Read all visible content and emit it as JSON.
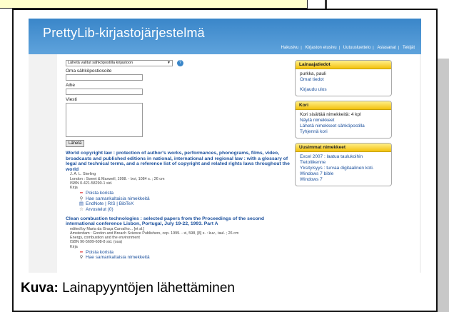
{
  "app": {
    "title": "PrettyLib-kirjastojärjestelmä",
    "nav": [
      "Hakusivu",
      "Kirjaston etusivu",
      "Uutuusluettelo",
      "Asiasanat",
      "Tekijät"
    ]
  },
  "form": {
    "select_label": "Lähetä valitut sähköpostilla kirjastoon",
    "email_label": "Oma sähköpostiosoite",
    "subject_label": "Aihe",
    "message_label": "Viesti",
    "send_button": "Lähetä"
  },
  "records": [
    {
      "title": "World copyright law : protection of author's works, performances, phonograms, films, video, broadcasts and published editions in national, international and regional law : with a glossary of legal and technical terms, and a reference list of copyright and related rights laws throughout the world",
      "meta": [
        "J. A. L. Sterling",
        "London : Sweet & Maxwell, 1998. - lxvi, 1084 s. ; 26 cm",
        "ISBN 0-421-58290-1 sid.",
        "Kirja"
      ],
      "actions": [
        {
          "icon": "remove-icon",
          "label": "Poista korista"
        },
        {
          "icon": "search-icon",
          "label": "Hae samankaltaisia nimekkeitä"
        },
        {
          "icon": "export-icon",
          "label": "EndNote | RIS | BibTeX"
        },
        {
          "icon": "star-icon",
          "label": "Arvostelut (0)"
        }
      ]
    },
    {
      "title": "Clean combustion technologies : selected papers from the Proceedings of the second international conference Lisbon, Portugal, July 19-22, 1993. Part A",
      "meta": [
        "edited by Maria da Graça Carvalho... [et al.]",
        "Amsterdam : Gordon and Breach Science Publishers, cop. 1999. - xi, 598, [8] s. : kuv., taul. ; 26 cm",
        "Energy, combustion and the environment",
        "ISBN 90-5699-608-8 sid. (osa)",
        "Kirja"
      ],
      "actions": [
        {
          "icon": "remove-icon",
          "label": "Poista korista"
        },
        {
          "icon": "search-icon",
          "label": "Hae samankaltaisia nimekkeitä"
        }
      ]
    }
  ],
  "panels": {
    "loan": {
      "header": "Lainaajatiedot",
      "user": "purkka, pauli",
      "own_info": "Omat tiedot",
      "logout": "Kirjaudu ulos"
    },
    "cart": {
      "header": "Kori",
      "count": "Kori sisältää nimekkeitä: 4 kpl",
      "links": [
        "Näytä nimekkeet",
        "Lähetä nimekkeet sähköpostilla",
        "Tyhjennä kori"
      ]
    },
    "newest": {
      "header": "Uusimmat nimekkeet",
      "items": [
        "Excel 2007 : laatua taulukoihin",
        "Tietoliikenne",
        "Yksityisyys : turvaa digitaalinen koti.",
        "Windows 7 bible",
        "Windows 7"
      ]
    }
  },
  "caption": {
    "bold": "Kuva:",
    "text": " Lainapyyntöjen lähettäminen"
  }
}
